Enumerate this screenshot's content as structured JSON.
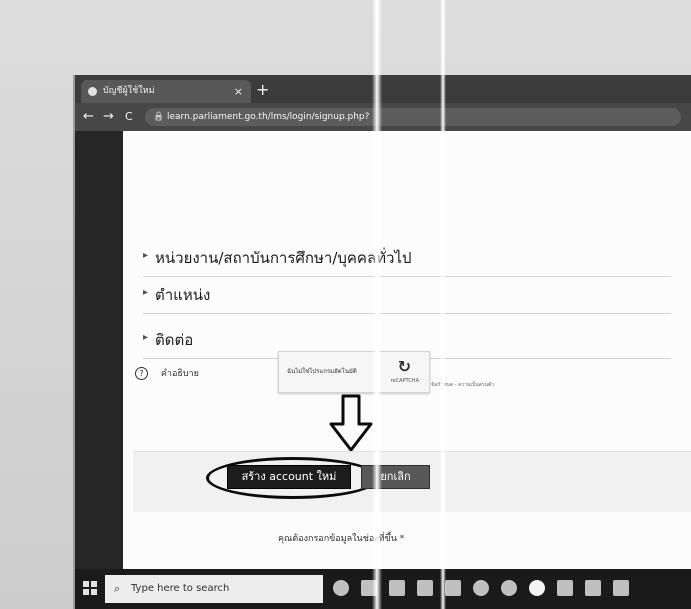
{
  "browser": {
    "tab_title": "บัญชีผู้ใช้ใหม่",
    "tab_close": "×",
    "new_tab": "+",
    "back": "←",
    "forward": "→",
    "reload": "C",
    "url": "learn.parliament.go.th/lms/login/signup.php?"
  },
  "form": {
    "fields": [
      {
        "label": "หน่วยงาน/สถาบันการศึกษา/บุคคลทั่วไป"
      },
      {
        "label": "ตำแหน่ง"
      },
      {
        "label": "ติดต่อ"
      }
    ],
    "help_label": "คำอธิบาย",
    "captcha": {
      "text": "ฉันไม่ใช่โปรแกรมอัตโนมัติ",
      "brand": "reCAPTCHA",
      "sub": "ข้อกำหนด - ความเป็นส่วนตัว"
    },
    "create_button": "สร้าง account ใหม่",
    "cancel_button": "ยกเลิก",
    "required_note": "คุณต้องกรอกข้อมูลในช่องที่ขึ้น *"
  },
  "taskbar": {
    "search_placeholder": "Type here to search"
  },
  "colors": {
    "taskbar": "#1f1f1f",
    "button_dark": "#222222"
  }
}
